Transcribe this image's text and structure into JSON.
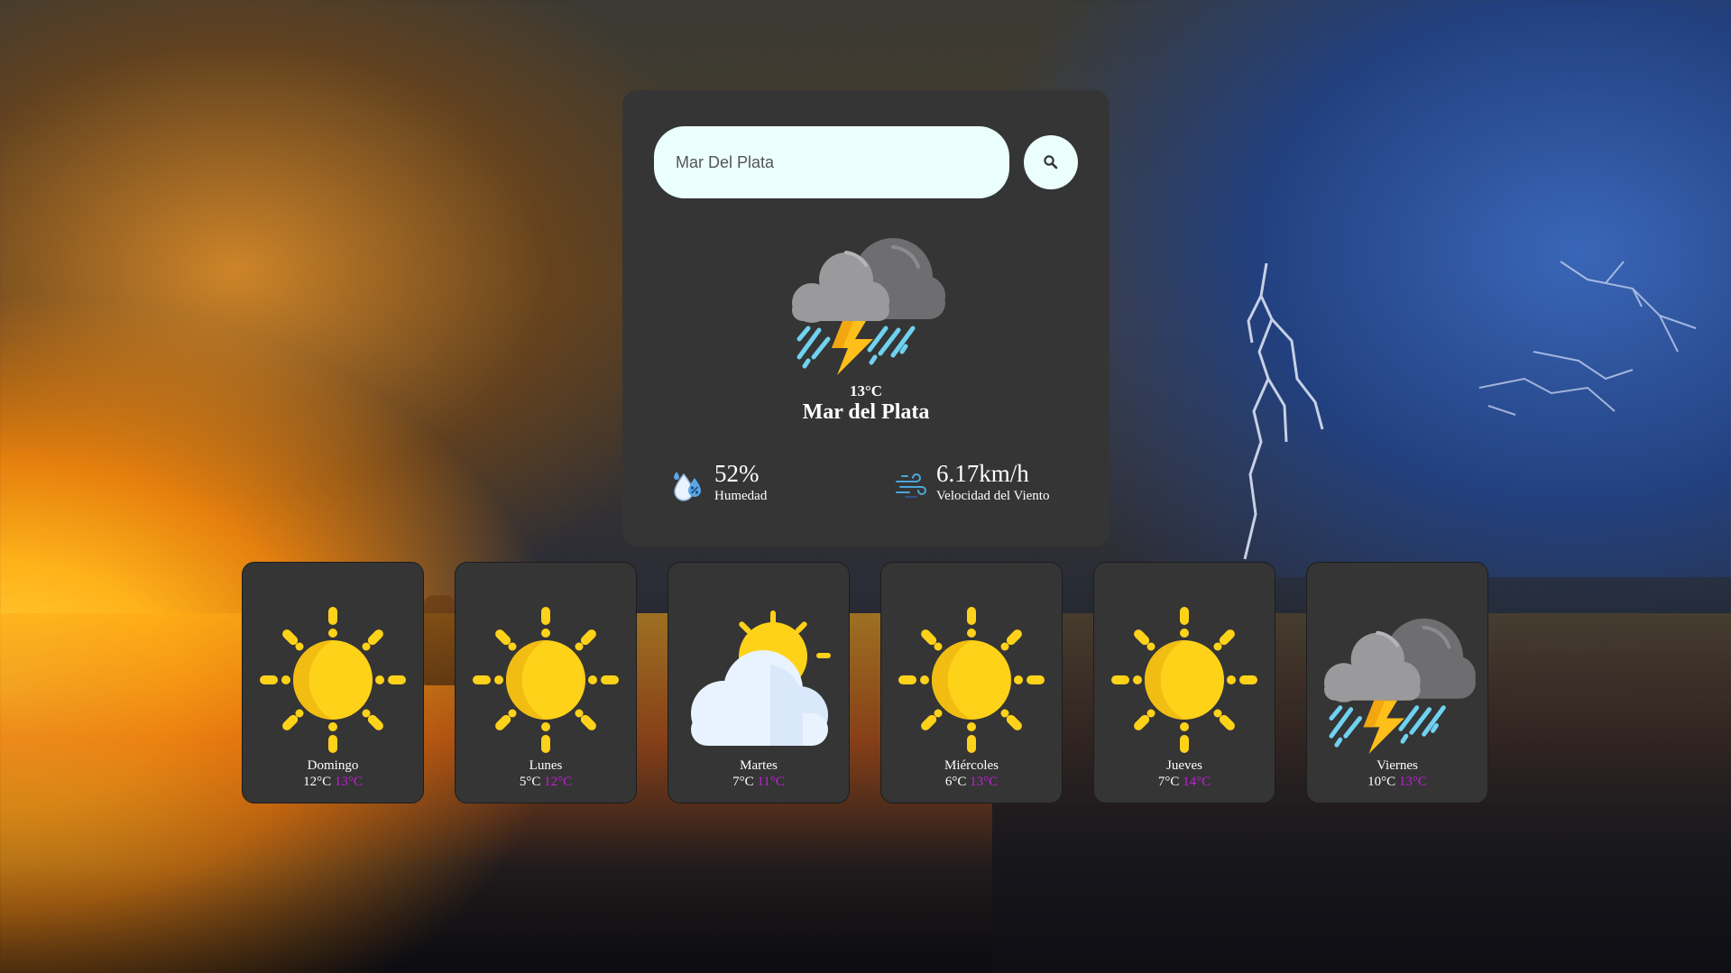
{
  "search": {
    "value": "Mar Del Plata"
  },
  "current": {
    "icon": "thunderstorm-rain-icon",
    "temperature": "13°C",
    "city": "Mar del Plata",
    "humidity": {
      "value": "52%",
      "label": "Humedad",
      "icon": "humidity-icon"
    },
    "wind": {
      "value": "6.17km/h",
      "label": "Velocidad del Viento",
      "icon": "wind-icon"
    }
  },
  "forecast": [
    {
      "day": "Domingo",
      "min": "12°C",
      "max": "13°C",
      "icon": "sun-icon"
    },
    {
      "day": "Lunes",
      "min": "5°C",
      "max": "12°C",
      "icon": "sun-icon"
    },
    {
      "day": "Martes",
      "min": "7°C",
      "max": "11°C",
      "icon": "partly-cloudy-icon"
    },
    {
      "day": "Miércoles",
      "min": "6°C",
      "max": "13°C",
      "icon": "sun-icon"
    },
    {
      "day": "Jueves",
      "min": "7°C",
      "max": "14°C",
      "icon": "sun-icon"
    },
    {
      "day": "Viernes",
      "min": "10°C",
      "max": "13°C",
      "icon": "thunderstorm-rain-icon"
    }
  ],
  "colors": {
    "card": "#353535",
    "max_temp": "#c21fd8",
    "search_bg": "#ebfffc",
    "sun": "#ffd21a"
  }
}
